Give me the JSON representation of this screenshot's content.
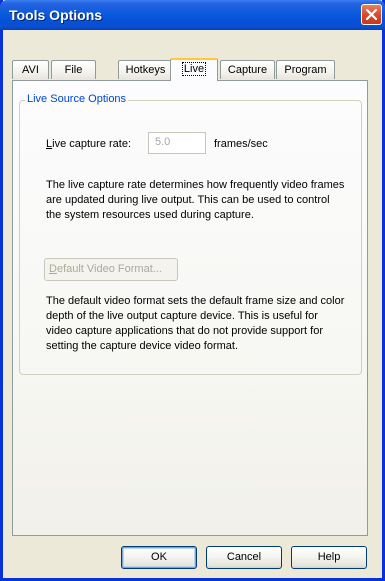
{
  "window": {
    "title": "Tools Options"
  },
  "tabs": [
    {
      "label": "AVI"
    },
    {
      "label": "File"
    },
    {
      "label": "Hotkeys"
    },
    {
      "label": "Live",
      "active": true
    },
    {
      "label": "Capture"
    },
    {
      "label": "Program"
    }
  ],
  "live": {
    "group_label": "Live Source Options",
    "rate_label_access": "L",
    "rate_label_rest": "ive capture rate:",
    "rate_value": "5.0",
    "rate_unit": "frames/sec",
    "rate_description": "The live capture rate determines how frequently video frames are updated during live output.  This can be used to control the system resources used during capture.",
    "format_button_access": "D",
    "format_button_rest": "efault Video Format...",
    "format_button_enabled": false,
    "format_description": "The default video format sets the default frame size and color depth of the live output capture device.  This is useful for video capture applications that do not provide support for setting the capture device video format."
  },
  "buttons": {
    "ok": "OK",
    "cancel": "Cancel",
    "help": "Help"
  },
  "colors": {
    "title_bar": "#0A5BDE",
    "close_button": "#DB4A2C",
    "active_tab_highlight": "#FFC83C",
    "group_label": "#0046D5",
    "disabled_text": "#ACA899"
  },
  "icons": {
    "close": "close-icon"
  }
}
